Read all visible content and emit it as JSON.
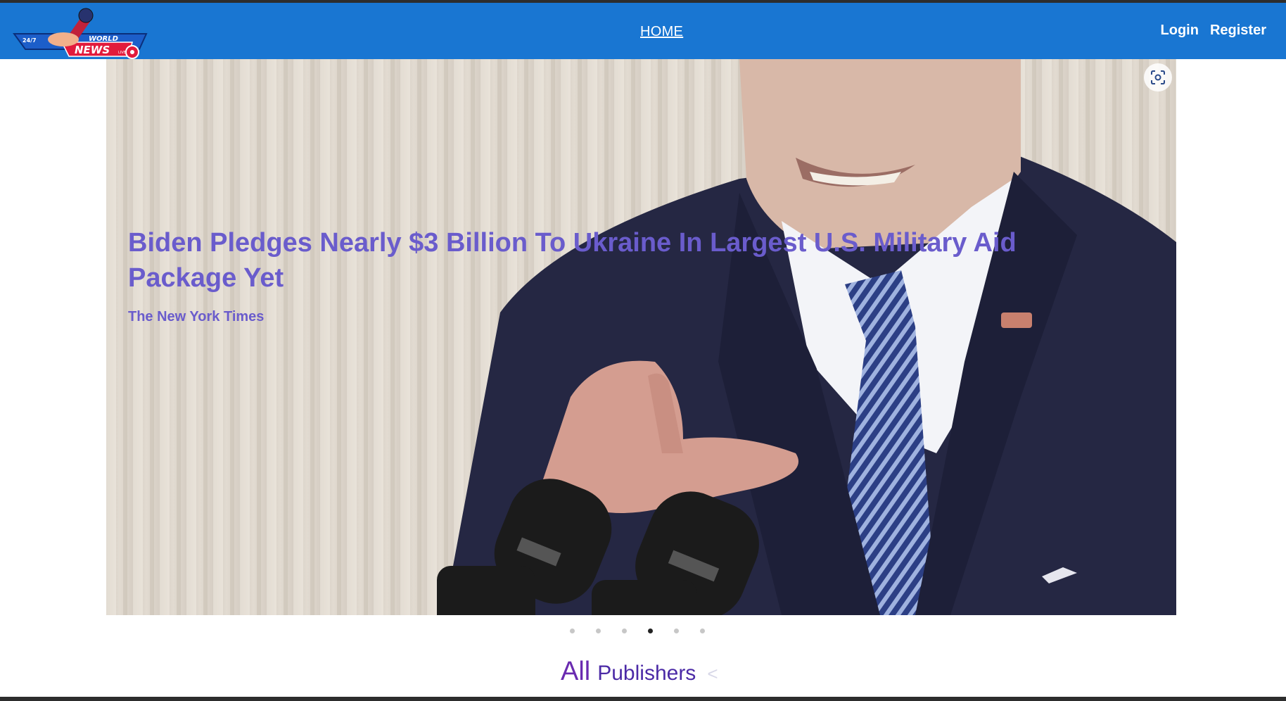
{
  "brand": {
    "logo_top_text": "24/7",
    "logo_world": "WORLD",
    "logo_news": "NEWS",
    "logo_live": "LIVE"
  },
  "nav": {
    "home": "HOME",
    "login": "Login",
    "register": "Register"
  },
  "hero": {
    "title": "Biden Pledges Nearly $3 Billion To Ukraine In Largest U.S. Military Aid Package Yet",
    "source": "The New York Times",
    "slide_count": 6,
    "active_slide": 4
  },
  "section": {
    "all": "All",
    "publishers": "Publishers",
    "arrow": "<"
  },
  "colors": {
    "nav_bg": "#1976d2",
    "title": "#6a5ccc",
    "publishers": "#6a2bb0"
  }
}
